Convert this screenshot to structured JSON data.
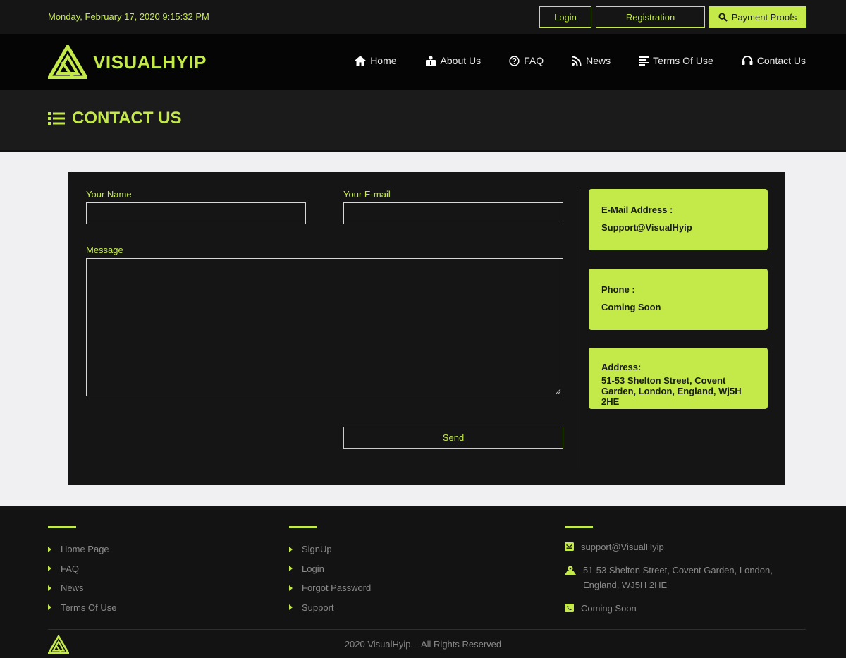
{
  "topbar": {
    "datetime": "Monday, February 17, 2020 9:15:32 PM",
    "login_label": "Login",
    "registration_label": "Registration",
    "payment_proofs_label": "Payment Proofs"
  },
  "brand": {
    "name": "VISUALHYIP",
    "accent_color": "#c4ea4a"
  },
  "nav": {
    "items": [
      {
        "label": "Home",
        "icon": "home-icon"
      },
      {
        "label": "About Us",
        "icon": "about-icon"
      },
      {
        "label": "FAQ",
        "icon": "question-circle-icon"
      },
      {
        "label": "News",
        "icon": "rss-icon"
      },
      {
        "label": "Terms Of Use",
        "icon": "list-lines-icon"
      },
      {
        "label": "Contact Us",
        "icon": "headset-icon"
      }
    ]
  },
  "page": {
    "title": "CONTACT US"
  },
  "form": {
    "name_label": "Your Name",
    "name_value": "",
    "email_label": "Your E-mail",
    "email_value": "",
    "message_label": "Message",
    "message_value": "",
    "send_label": "Send"
  },
  "contact_cards": {
    "email_key": "E-Mail Address :",
    "email_value": "Support@VisualHyip",
    "phone_key": "Phone :",
    "phone_value": "Coming Soon",
    "address_key": "Address:",
    "address_value": "51-53 Shelton Street, Covent Garden, London, England, Wj5H 2HE"
  },
  "footer": {
    "col1": [
      "Home Page",
      "FAQ",
      "News",
      "Terms Of Use"
    ],
    "col2": [
      "SignUp",
      "Login",
      "Forgot Password",
      "Support"
    ],
    "contact": {
      "email": "support@VisualHyip",
      "address": "51-53 Shelton Street, Covent Garden, London, England, WJ5H 2HE",
      "phone": "Coming Soon"
    },
    "copyright": "2020 VisualHyip. - All Rights Reserved"
  }
}
